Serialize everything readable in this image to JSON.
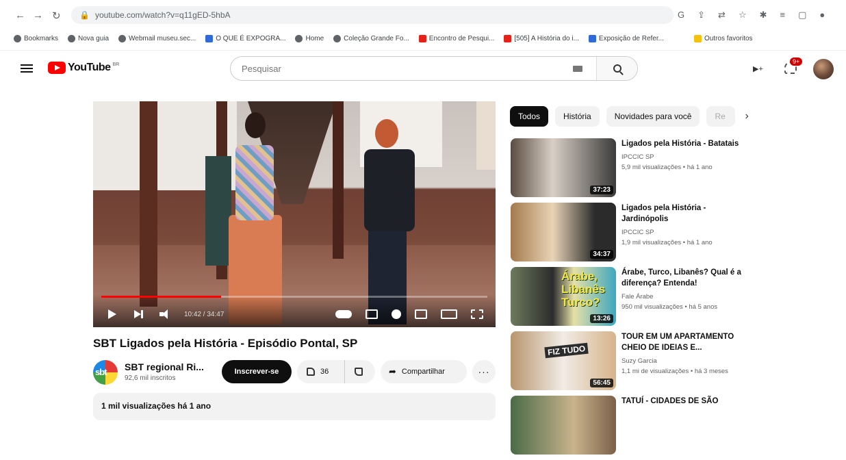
{
  "browser": {
    "url": "youtube.com/watch?v=q11gED-5hbA",
    "bookmarks": [
      {
        "label": "Bookmarks",
        "icon": "star-icon"
      },
      {
        "label": "Nova guia",
        "icon": "globe-icon"
      },
      {
        "label": "Webmail museu.sec...",
        "icon": "globe-icon"
      },
      {
        "label": "O QUE É EXPOGRA...",
        "icon": "sparkle-icon"
      },
      {
        "label": "Home",
        "icon": "globe-icon"
      },
      {
        "label": "Coleção Grande Fo...",
        "icon": "globe-icon"
      },
      {
        "label": "Encontro de Pesqui...",
        "icon": "youtube-icon"
      },
      {
        "label": "[505] A História do i...",
        "icon": "youtube-icon"
      },
      {
        "label": "Exposição de Refer...",
        "icon": "image-icon"
      },
      {
        "label": "Outros favoritos",
        "icon": "folder-icon"
      }
    ]
  },
  "header": {
    "logo_text": "YouTube",
    "logo_sup": "BR",
    "search_placeholder": "Pesquisar",
    "notification_count": "9+"
  },
  "player": {
    "time": "10:42 / 34:47",
    "progress": 0.31
  },
  "video": {
    "title": "SBT Ligados pela História - Episódio Pontal, SP",
    "channel_name": "SBT regional Ri...",
    "channel_avatar_text": "sbt",
    "subscribers": "92,6 mil inscritos",
    "subscribe_label": "Inscrever-se",
    "likes": "36",
    "share_label": "Compartilhar",
    "more_label": "···",
    "description_preview": "1 mil visualizações  há 1 ano"
  },
  "chips": [
    {
      "label": "Todos",
      "active": true
    },
    {
      "label": "História",
      "active": false
    },
    {
      "label": "Novidades para você",
      "active": false
    },
    {
      "label": "Re",
      "active": false
    }
  ],
  "related": [
    {
      "title": "Ligados pela História - Batatais",
      "channel": "IPCCIC SP",
      "meta": "5,9 mil visualizações  •  há 1 ano",
      "duration": "37:23"
    },
    {
      "title": "Ligados pela História - Jardinópolis",
      "channel": "IPCCIC SP",
      "meta": "1,9 mil visualizações  •  há 1 ano",
      "duration": "34:37"
    },
    {
      "title": "Árabe, Turco, Libanês? Qual é a diferença? Entenda!",
      "channel": "Fale Árabe",
      "meta": "950 mil visualizações  •  há 5 anos",
      "duration": "13:26",
      "thumb_text": "Árabe, Libanês Turco?"
    },
    {
      "title": "TOUR EM UM APARTAMENTO CHEIO DE IDEIAS E...",
      "channel": "Suzy Garcia",
      "meta": "1,1 mi de visualizações  •  há 3 meses",
      "duration": "56:45",
      "thumb_text": "FIZ TUDO"
    },
    {
      "title": "TATUÍ - CIDADES DE SÃO",
      "channel": "",
      "meta": "",
      "duration": ""
    }
  ]
}
